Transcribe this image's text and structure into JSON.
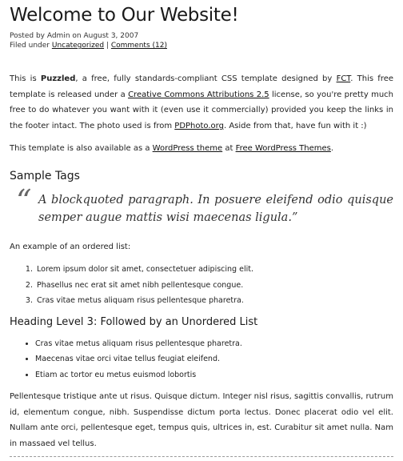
{
  "post": {
    "title": "Welcome to Our Website!",
    "posted_by": "Posted by Admin on August 3, 2007",
    "filed_prefix": "Filed under ",
    "category": "Uncategorized",
    "separator": " | ",
    "comments": "Comments (12)"
  },
  "para1": {
    "t1": "This is ",
    "bold": "Puzzled",
    "t2": ", a free, fully standards-compliant CSS template designed by ",
    "link1": "FCT",
    "t3": ". This free template is released under a ",
    "link2": "Creative Commons Attributions 2.5",
    "t4": " license, so you're pretty much free to do whatever you want with it (even use it commercially) provided you keep the links in the footer intact. The photo used is from ",
    "link3": "PDPhoto.org",
    "t5": ". Aside from that, have fun with it :)"
  },
  "para2": {
    "t1": "This template is also available as a ",
    "link1": "WordPress theme",
    "t2": " at ",
    "link2": "Free WordPress Themes",
    "t3": "."
  },
  "sample_tags_heading": "Sample Tags",
  "blockquote": {
    "mark": "“",
    "text": "A blockquoted paragraph. In posuere eleifend odio quisque semper augue mattis wisi maecenas ligula.”"
  },
  "ordered_intro": "An example of an ordered list:",
  "ordered_list": [
    "Lorem ipsum dolor sit amet, consectetuer adipiscing elit.",
    "Phasellus nec erat sit amet nibh pellentesque congue.",
    "Cras vitae metus aliquam risus pellentesque pharetra."
  ],
  "heading3": "Heading Level 3: Followed by an Unordered List",
  "unordered_list": [
    "Cras vitae metus aliquam risus pellentesque pharetra.",
    "Maecenas vitae orci vitae tellus feugiat eleifend.",
    "Etiam ac tortor eu metus euismod lobortis"
  ],
  "final_paragraph": "Pellentesque tristique ante ut risus. Quisque dictum. Integer nisl risus, sagittis convallis, rutrum id, elementum congue, nibh. Suspendisse dictum porta lectus. Donec placerat odio vel elit. Nullam ante orci, pellentesque eget, tempus quis, ultrices in, est. Curabitur sit amet nulla. Nam in massaed vel tellus."
}
